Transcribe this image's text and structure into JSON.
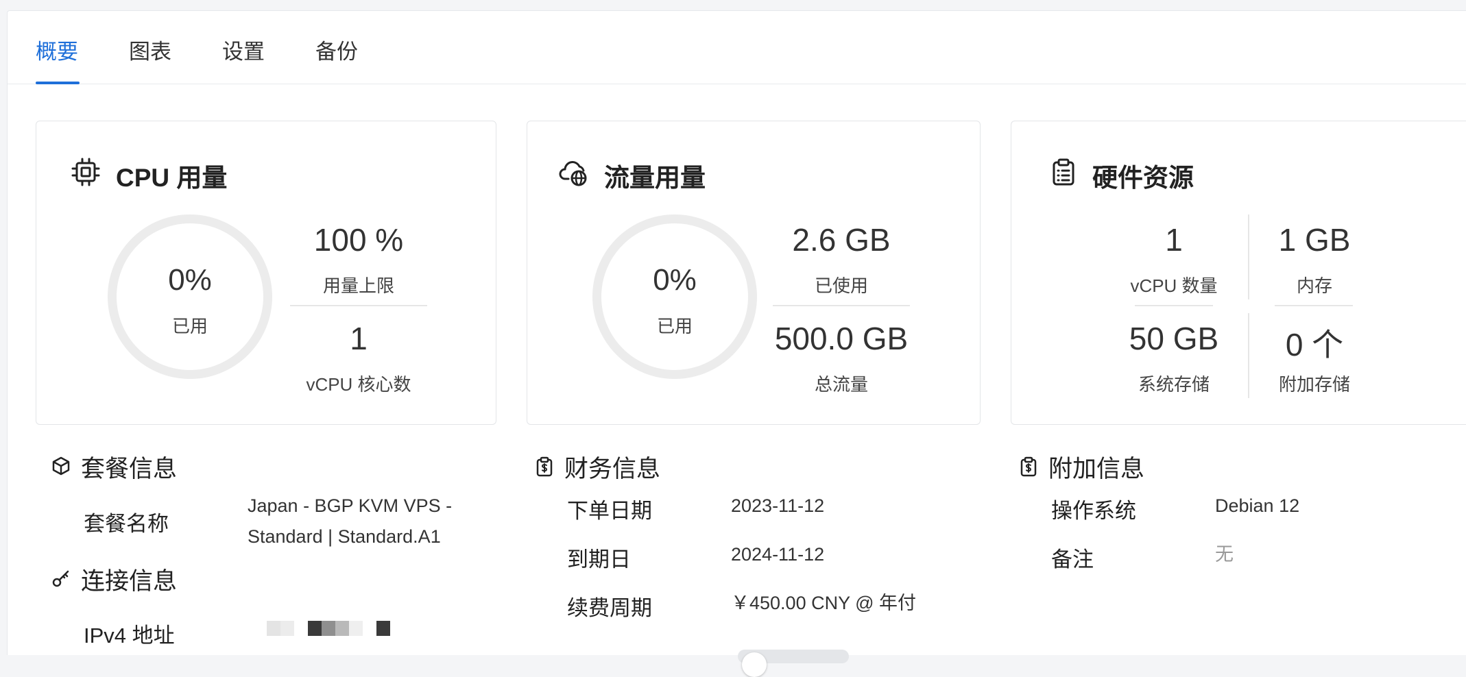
{
  "tabs": [
    {
      "label": "概要",
      "active": true
    },
    {
      "label": "图表",
      "active": false
    },
    {
      "label": "设置",
      "active": false
    },
    {
      "label": "备份",
      "active": false
    }
  ],
  "cpu": {
    "title": "CPU 用量",
    "icon": "cpu-chip-icon",
    "used_percent_text": "0%",
    "used_percent": 0,
    "used_label": "已用",
    "limit_value": "100 %",
    "limit_label": "用量上限",
    "cores_value": "1",
    "cores_label": "vCPU 核心数"
  },
  "traffic": {
    "title": "流量用量",
    "icon": "cloud-globe-icon",
    "used_percent_text": "0%",
    "used_percent": 0,
    "used_label": "已用",
    "used_value": "2.6 GB",
    "used_value_label": "已使用",
    "total_value": "500.0 GB",
    "total_label": "总流量"
  },
  "hardware": {
    "title": "硬件资源",
    "icon": "clipboard-list-icon",
    "vcpu_value": "1",
    "vcpu_label": "vCPU 数量",
    "memory_value": "1 GB",
    "memory_label": "内存",
    "storage_value": "50 GB",
    "storage_label": "系统存储",
    "extra_storage_value": "0 个",
    "extra_storage_label": "附加存储"
  },
  "plan_info": {
    "title": "套餐信息",
    "icon": "package-icon",
    "name_key": "套餐名称",
    "name_line1": "Japan - BGP KVM VPS -",
    "name_line2": "Standard | Standard.A1"
  },
  "connection_info": {
    "title": "连接信息",
    "icon": "key-icon",
    "ipv4_key": "IPv4 地址"
  },
  "finance_info": {
    "title": "财务信息",
    "icon": "clipboard-dollar-icon",
    "order_date_key": "下单日期",
    "order_date": "2023-11-12",
    "expire_key": "到期日",
    "expire_date": "2024-11-12",
    "renew_key": "续费周期",
    "renew_value": "￥450.00 CNY @ 年付",
    "auto_renew_enabled": false
  },
  "extra_info": {
    "title": "附加信息",
    "icon": "clipboard-dollar-icon",
    "os_key": "操作系统",
    "os_value": "Debian 12",
    "note_key": "备注",
    "note_value": "无"
  },
  "colors": {
    "accent": "#1e6fd9",
    "ring_track": "#ececec"
  }
}
